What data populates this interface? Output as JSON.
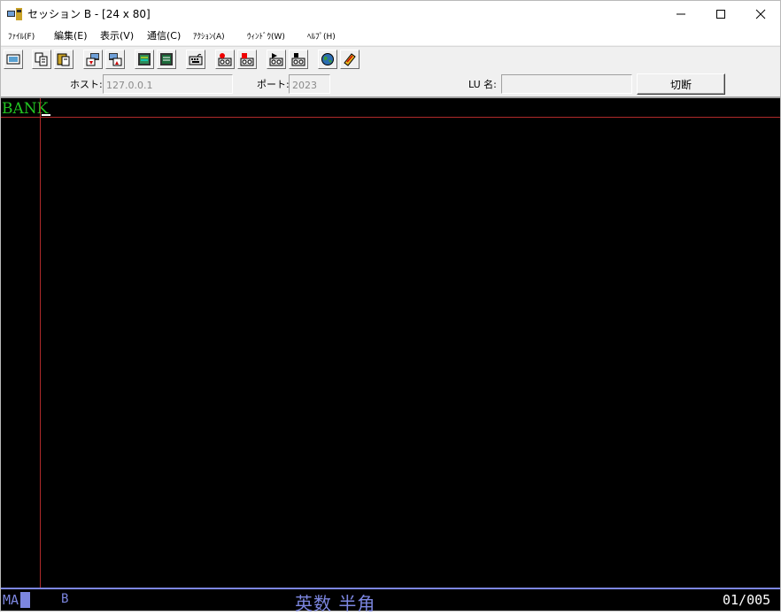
{
  "window": {
    "title": "セッション B - [24 x 80]",
    "minimize_glyph": "—",
    "maximize_glyph": "☐",
    "close_glyph": "✕"
  },
  "menu": {
    "items": [
      {
        "label": "ﾌｧｲﾙ(F)"
      },
      {
        "label": "編集(E)"
      },
      {
        "label": "表示(V)"
      },
      {
        "label": "通信(C)"
      },
      {
        "label": "ｱｸｼｮﾝ(A)"
      },
      {
        "label": "ｳｨﾝﾄﾞｳ(W)"
      },
      {
        "label": "ﾍﾙﾌﾟ(H)"
      }
    ]
  },
  "toolbar": {
    "buttons": [
      {
        "icon": "print-screen-icon"
      },
      {
        "icon": "copy-icon"
      },
      {
        "icon": "paste-icon"
      },
      {
        "icon": "send-file-icon"
      },
      {
        "icon": "receive-file-icon"
      },
      {
        "icon": "display-setup-icon"
      },
      {
        "icon": "screen-setup-icon"
      },
      {
        "icon": "keyboard-icon"
      },
      {
        "icon": "macro-record-icon"
      },
      {
        "icon": "macro-stop-icon"
      },
      {
        "icon": "macro-play-icon"
      },
      {
        "icon": "macro-pause-icon"
      },
      {
        "icon": "globe-icon"
      },
      {
        "icon": "help-book-icon"
      }
    ]
  },
  "connection": {
    "host_label": "ホスト:",
    "host_value": "127.0.0.1",
    "port_label": "ポート:",
    "port_value": "2023",
    "lu_label": "LU 名:",
    "lu_value": "",
    "disconnect_label": "切断"
  },
  "terminal": {
    "line1": "BANK"
  },
  "status": {
    "mode": "MA",
    "session": "B",
    "ime": "英数 半角",
    "position": "01/005",
    "accent": "#7c86e0",
    "text_green": "#22c722"
  }
}
